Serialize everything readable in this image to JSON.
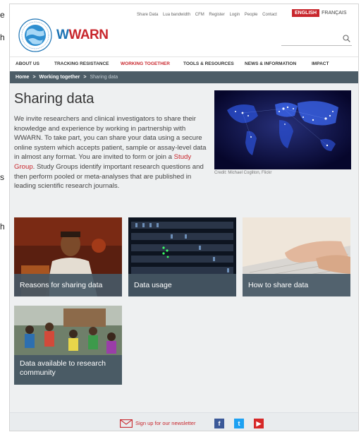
{
  "left_fragments": [
    "e",
    "h",
    "s",
    "h"
  ],
  "site": {
    "brand_prefix": "W",
    "brand": "WARN",
    "util_links": [
      "Share Data",
      "Lua bandwidth",
      "CFM",
      "Register",
      "Login",
      "People",
      "Contact"
    ],
    "lang_en": "ENGLISH",
    "lang_fr": "FRANÇAIS"
  },
  "nav": [
    "ABOUT US",
    "TRACKING RESISTANCE",
    "WORKING TOGETHER",
    "TOOLS & RESOURCES",
    "NEWS & INFORMATION",
    "IMPACT"
  ],
  "breadcrumb": {
    "home": "Home",
    "sep": ">",
    "section": "Working together",
    "current": "Sharing data"
  },
  "page": {
    "title": "Sharing data",
    "intro_before": "We invite researchers and clinical investigators to share their knowledge and experience by working in partnership with WWARN. To take part, you can share your data using a secure online system which accepts patient, sample or assay-level data in almost any format. You are invited to form or join a ",
    "intro_link": "Study Group",
    "intro_after": ". Study Groups identify important research questions and then perform pooled or meta-analyses that are published in leading scientific research journals.",
    "credit": "Credit: Michael Cogliton, Flickr"
  },
  "tiles": [
    {
      "label": "Reasons for sharing data"
    },
    {
      "label": "Data usage"
    },
    {
      "label": "How to share data"
    },
    {
      "label": "Data available to research community"
    }
  ],
  "footer": {
    "newsletter": "Sign up for our newsletter",
    "social": [
      "f",
      "t",
      "▶"
    ]
  },
  "colors": {
    "brand_red": "#c8262c",
    "brand_blue": "#1c73b4",
    "caption_bg": "#465865",
    "breadcrumb_bg": "#4d5d67"
  }
}
